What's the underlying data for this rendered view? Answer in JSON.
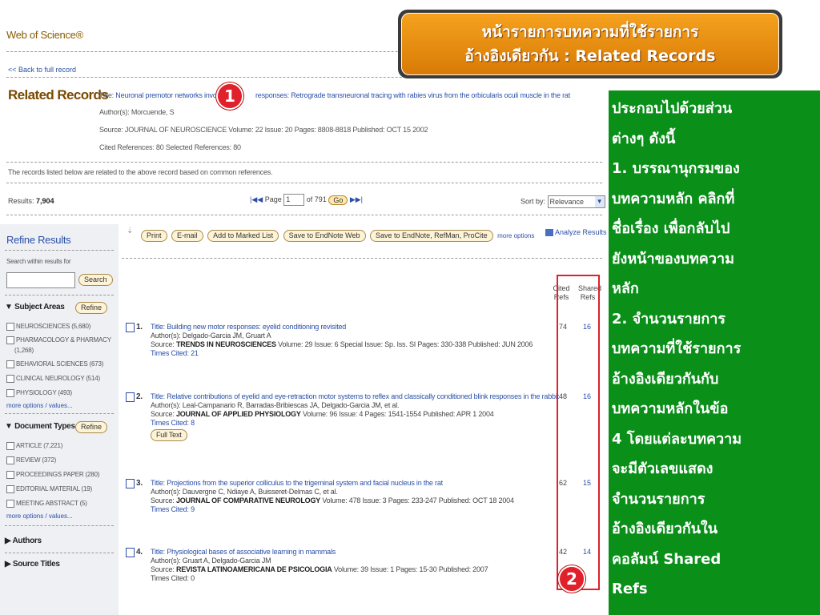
{
  "header": {
    "app_title": "Web of Science®",
    "back_link": "<< Back to full record"
  },
  "related": {
    "heading": "Related Records",
    "title_label": "Title:",
    "title_part1": "Neuronal premotor networks involved",
    "title_part2": "responses: Retrograde transneuronal tracing with rabies virus from the orbicularis oculi muscle in the rat",
    "authors_label": "Author(s):",
    "authors": "Morcuende, S",
    "source_line": "Source: JOURNAL OF NEUROSCIENCE Volume: 22 Issue: 20 Pages: 8808-8818 Published: OCT 15 2002",
    "cited_line": "Cited References: 80 Selected References: 80",
    "note": "The records listed below are related to the above record based on common references."
  },
  "results": {
    "label": "Results:",
    "count": "7,904",
    "page_label": "Page",
    "page_value": "1",
    "of_pages": "of 791",
    "go": "Go",
    "sort_label": "Sort by:",
    "sort_value": "Relevance"
  },
  "toolbar": {
    "print": "Print",
    "email": "E-mail",
    "marked": "Add to Marked List",
    "save_web": "Save to EndNote Web",
    "save_refman": "Save to EndNote, RefMan, ProCite",
    "more": "more options",
    "analyze": "Analyze Results"
  },
  "sidebar": {
    "title": "Refine Results",
    "search_label": "Search within results for",
    "search_button": "Search",
    "refine_button": "Refine",
    "subject_title": "Subject Areas",
    "subjects": [
      "NEUROSCIENCES (5,680)",
      "PHARMACOLOGY & PHARMACY",
      "(1,268)",
      "BEHAVIORAL SCIENCES (673)",
      "CLINICAL NEUROLOGY (514)",
      "PHYSIOLOGY (493)"
    ],
    "more_values": "more options / values...",
    "doc_title": "Document Types",
    "doctypes": [
      "ARTICLE (7,221)",
      "REVIEW (372)",
      "PROCEEDINGS PAPER (280)",
      "EDITORIAL MATERIAL (19)",
      "MEETING ABSTRACT (5)"
    ],
    "authors_title": "Authors",
    "source_title": "Source Titles"
  },
  "columns": {
    "cited": "Cited Refs",
    "shared": "Shared Refs"
  },
  "records": [
    {
      "num": "1.",
      "title": "Title: Building new motor responses: eyelid conditioning revisited",
      "authors": "Author(s): Delgado-Garcia JM, Gruart A",
      "source_pre": "Source:",
      "journal": "TRENDS IN NEUROSCIENCES",
      "source_post": "Volume: 29 Issue: 6 Special Issue: Sp. Iss. SI Pages: 330-338 Published: JUN 2006",
      "times_cited": "Times Cited: 21",
      "cited": "74",
      "shared": "16"
    },
    {
      "num": "2.",
      "title": "Title: Relative contributions of eyelid and eye-retraction motor systems to reflex and classically conditioned blink responses in the rabbit",
      "authors": "Author(s): Leal-Campanario R, Barradas-Bribiescas JA, Delgado-Garcia JM, et al.",
      "source_pre": "Source:",
      "journal": "JOURNAL OF APPLIED PHYSIOLOGY",
      "source_post": "Volume: 96 Issue: 4 Pages: 1541-1554 Published: APR 1 2004",
      "times_cited": "Times Cited: 8",
      "full_text": "Full Text",
      "cited": "48",
      "shared": "16"
    },
    {
      "num": "3.",
      "title": "Title: Projections from the superior colliculus to the trigeminal system and facial nucleus in the rat",
      "authors": "Author(s): Dauvergne C, Ndiaye A, Buisseret-Delmas C, et al.",
      "source_pre": "Source:",
      "journal": "JOURNAL OF COMPARATIVE NEUROLOGY",
      "source_post": "Volume: 478 Issue: 3 Pages: 233-247 Published: OCT 18 2004",
      "times_cited": "Times Cited: 9",
      "cited": "62",
      "shared": "15"
    },
    {
      "num": "4.",
      "title": "Title: Physiological bases of associative learning in mammals",
      "authors": "Author(s): Gruart A, Delgado-Garcia JM",
      "source_pre": "Source:",
      "journal": "REVISTA LATINOAMERICANA DE PSICOLOGIA",
      "source_post": "Volume: 39 Issue: 1 Pages: 15-30 Published: 2007",
      "times_cited": "Times Cited: 0",
      "cited": "42",
      "shared": "14"
    }
  ],
  "callout": {
    "line1": "หน้ารายการบทความที่ใช้รายการ",
    "line2": "อ้างอิงเดียวกัน : Related Records"
  },
  "explanation": {
    "lines": [
      "ประกอบไปด้วยส่วน",
      "ต่างๆ ดังนี้",
      "1. บรรณานุกรมของ",
      "บทความหลัก คลิกที่",
      "ชื่อเรื่อง เพื่อกลับไป",
      "ยังหน้าของบทความ",
      "หลัก",
      "2. จำนวนรายการ",
      "บทความที่ใช้รายการ",
      "อ้างอิงเดียวกันกับ",
      "บทความหลักในข้อ",
      "4 โดยแต่ละบทความ",
      "จะมีตัวเลขแสดง",
      "จำนวนรายการ",
      "อ้างอิงเดียวกันใน",
      "คอลัมน์ Shared",
      "Refs"
    ]
  },
  "markers": {
    "m1": "1",
    "m2": "2"
  },
  "colors": {
    "callout": "#f5a21e",
    "panel": "#0a8f19",
    "marker": "#e0202a",
    "link": "#2a4fa8"
  }
}
